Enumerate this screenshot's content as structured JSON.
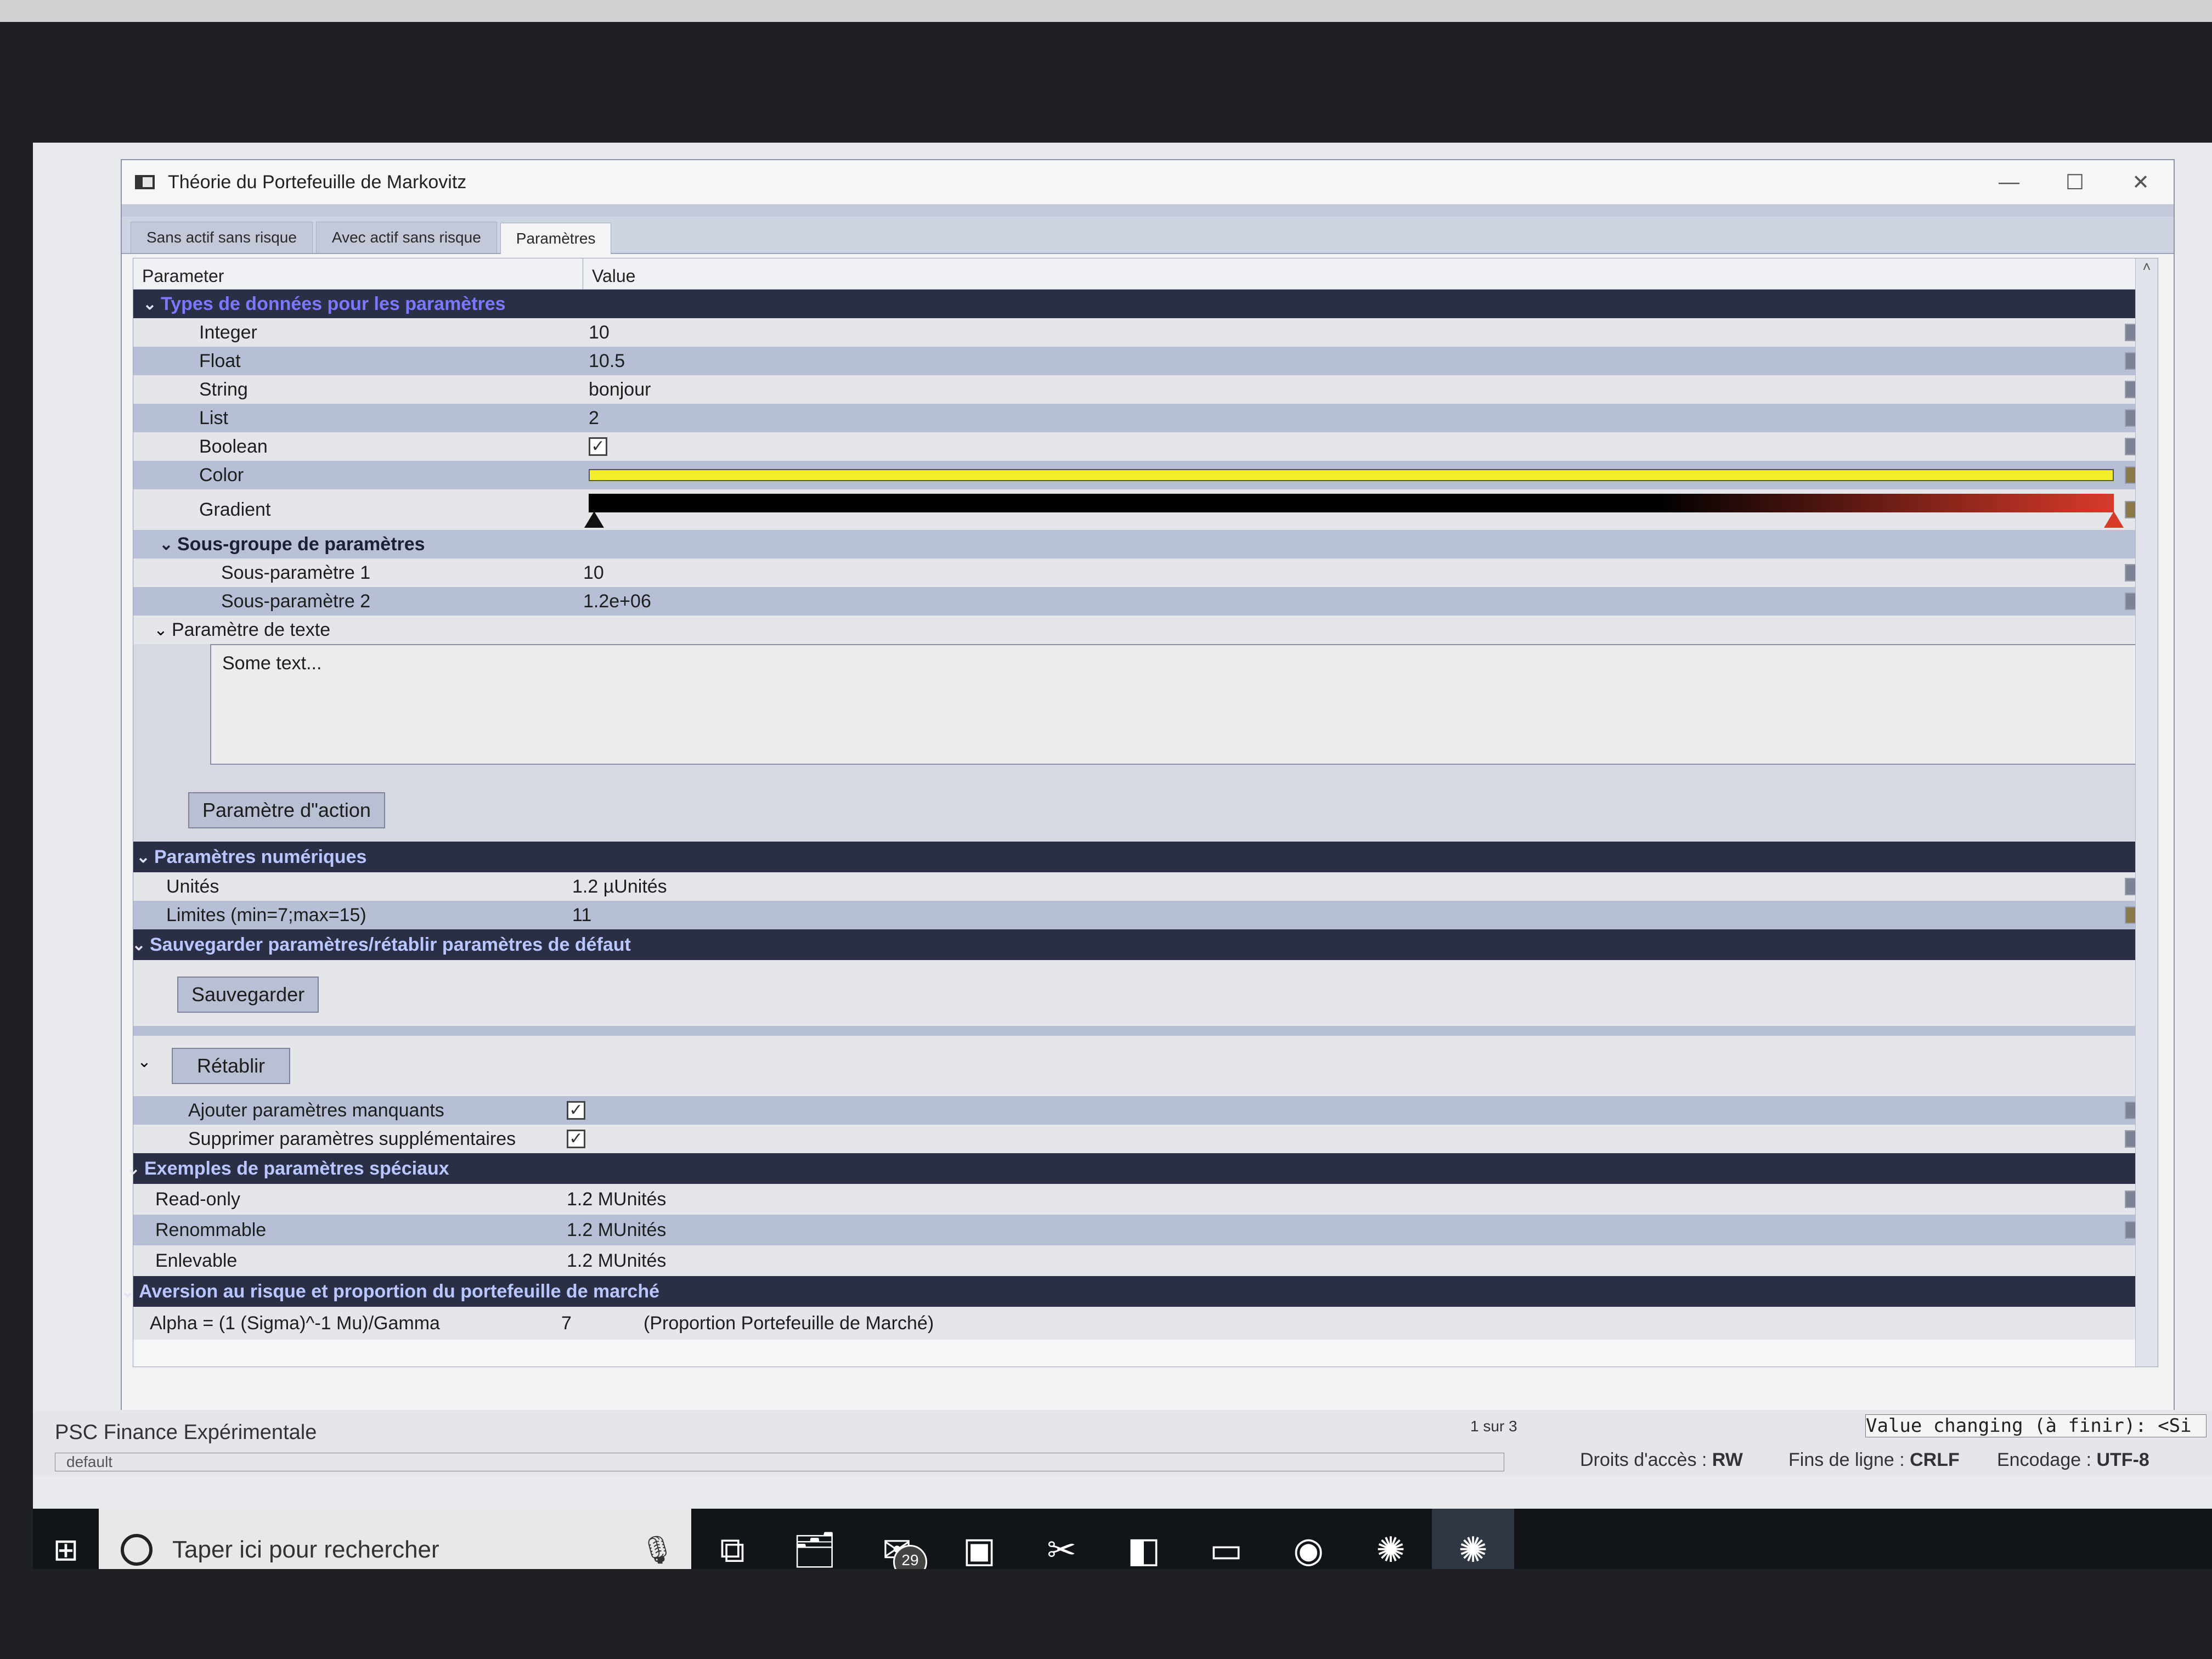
{
  "window": {
    "title": "Théorie du Portefeuille de Markovitz"
  },
  "tabs": [
    {
      "label": "Sans actif sans risque"
    },
    {
      "label": "Avec actif sans risque"
    },
    {
      "label": "Paramètres"
    }
  ],
  "grid": {
    "headers": {
      "parameter": "Parameter",
      "value": "Value"
    },
    "types_group": {
      "title": "Types de données pour les paramètres",
      "integer": {
        "name": "Integer",
        "value": "10"
      },
      "float": {
        "name": "Float",
        "value": "10.5"
      },
      "string": {
        "name": "String",
        "value": "bonjour"
      },
      "list": {
        "name": "List",
        "value": "2"
      },
      "boolean": {
        "name": "Boolean",
        "checked": true
      },
      "color": {
        "name": "Color",
        "swatch": "#f2ee2a"
      },
      "gradient": {
        "name": "Gradient",
        "start": "#000000",
        "end": "#d83a2a"
      }
    },
    "subgroup": {
      "title": "Sous-groupe de paramètres",
      "p1": {
        "name": "Sous-paramètre 1",
        "value": "10"
      },
      "p2": {
        "name": "Sous-paramètre 2",
        "value": "1.2e+06"
      }
    },
    "text_param": {
      "title": "Paramètre de texte",
      "text": "Some text..."
    },
    "action_button": "Paramètre d\"action",
    "numeric_group": {
      "title": "Paramètres numériques",
      "units": {
        "name": "Unités",
        "value": "1.2 µUnités"
      },
      "limits": {
        "name": "Limites (min=7;max=15)",
        "value": "11"
      }
    },
    "save_group": {
      "title": "Sauvegarder paramètres/rétablir paramètres de défaut",
      "save_button": "Sauvegarder",
      "restore_button": "Rétablir",
      "add_missing": {
        "name": "Ajouter paramètres manquants",
        "checked": true
      },
      "remove_extra": {
        "name": "Supprimer paramètres supplémentaires",
        "checked": true
      }
    },
    "special_group": {
      "title": "Exemples de paramètres spéciaux",
      "readonly": {
        "name": "Read-only",
        "value": "1.2 MUnités"
      },
      "renamable": {
        "name": "Renommable",
        "value": "1.2 MUnités"
      },
      "removable": {
        "name": "Enlevable",
        "value": "1.2 MUnités"
      }
    },
    "risk_group": {
      "title": "Aversion au risque et proportion du portefeuille de marché",
      "alpha": {
        "name": "Alpha = (1 (Sigma)^-1 Mu)/Gamma",
        "value": "7",
        "note": "(Proportion Portefeuille de Marché)"
      }
    }
  },
  "statusbar": {
    "project": "PSC Finance Expérimentale",
    "profile": "default",
    "search_count": "1 sur 3",
    "find_text": "Value changing (à finir): <Si",
    "access_label": "Droits d'accès :",
    "access_value": "RW",
    "eol_label": "Fins de ligne :",
    "eol_value": "CRLF",
    "encoding_label": "Encodage :",
    "encoding_value": "UTF-8"
  },
  "taskbar": {
    "search_placeholder": "Taper ici pour rechercher",
    "mail_count": "29"
  }
}
